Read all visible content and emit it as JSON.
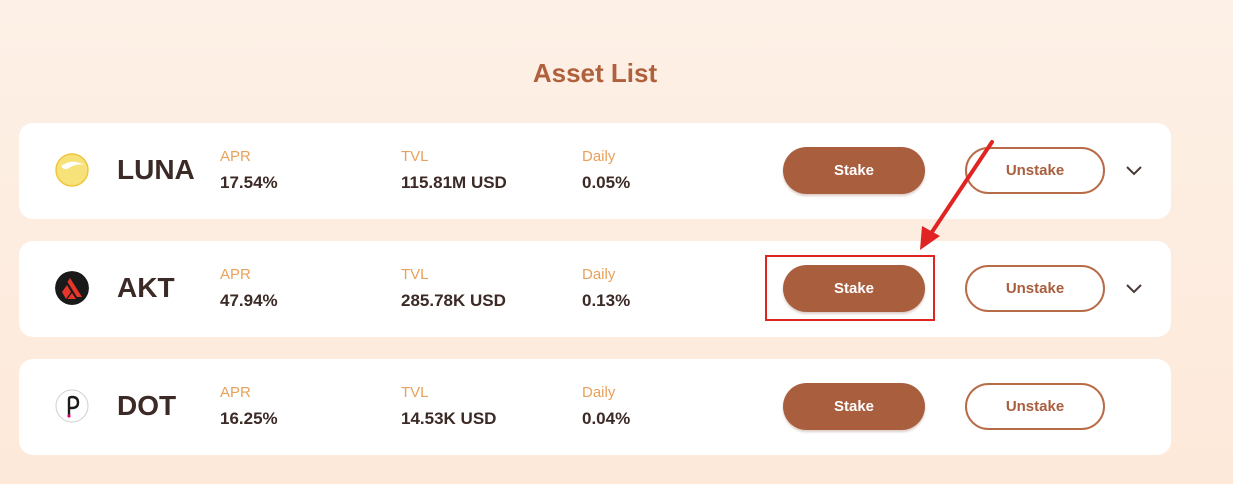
{
  "header": {
    "title": "Asset List"
  },
  "labels": {
    "apr": "APR",
    "tvl": "TVL",
    "daily": "Daily",
    "stake": "Stake",
    "unstake": "Unstake"
  },
  "assets": [
    {
      "name": "LUNA",
      "icon": "luna-icon",
      "apr": "17.54%",
      "tvl": "115.81M USD",
      "daily": "0.05%",
      "expandable": true
    },
    {
      "name": "AKT",
      "icon": "akash-icon",
      "apr": "47.94%",
      "tvl": "285.78K USD",
      "daily": "0.13%",
      "expandable": true
    },
    {
      "name": "DOT",
      "icon": "polkadot-icon",
      "apr": "16.25%",
      "tvl": "14.53K USD",
      "daily": "0.04%",
      "expandable": false
    }
  ],
  "annotation": {
    "highlighted": "AKT Stake button",
    "color": "#e02424"
  },
  "colors": {
    "accent": "#a95e3e",
    "label": "#e8a15a",
    "title": "#b0603c"
  }
}
